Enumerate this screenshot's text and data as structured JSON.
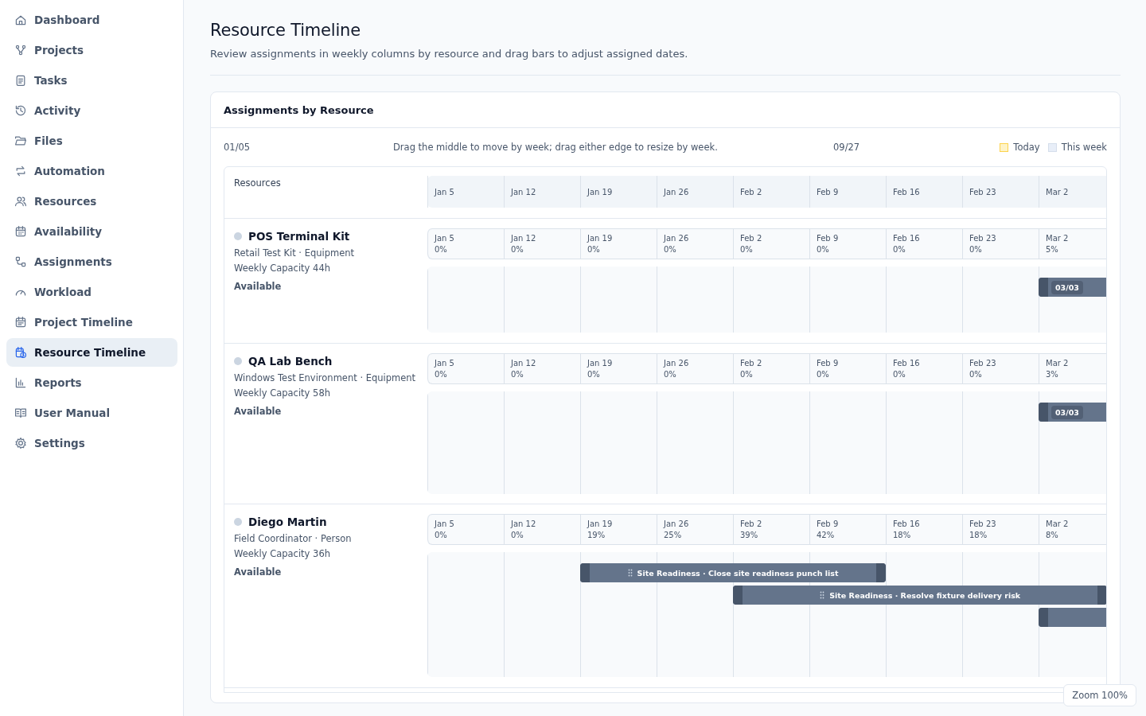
{
  "sidebar": {
    "items": [
      {
        "label": "Dashboard",
        "selected": false
      },
      {
        "label": "Projects",
        "selected": false
      },
      {
        "label": "Tasks",
        "selected": false
      },
      {
        "label": "Activity",
        "selected": false
      },
      {
        "label": "Files",
        "selected": false
      },
      {
        "label": "Automation",
        "selected": false
      },
      {
        "label": "Resources",
        "selected": false
      },
      {
        "label": "Availability",
        "selected": false
      },
      {
        "label": "Assignments",
        "selected": false
      },
      {
        "label": "Workload",
        "selected": false
      },
      {
        "label": "Project Timeline",
        "selected": false
      },
      {
        "label": "Resource Timeline",
        "selected": true
      },
      {
        "label": "Reports",
        "selected": false
      },
      {
        "label": "User Manual",
        "selected": false
      },
      {
        "label": "Settings",
        "selected": false
      }
    ]
  },
  "page": {
    "title": "Resource Timeline",
    "subtitle": "Review assignments in weekly columns by resource and drag bars to adjust assigned dates."
  },
  "card": {
    "title": "Assignments by Resource",
    "range_start": "01/05",
    "hint": "Drag the middle to move by week; drag either edge to resize by week.",
    "range_end": "09/27",
    "legend": [
      {
        "label": "Today",
        "color": "#fef3c7"
      },
      {
        "label": "This week",
        "color": "#e8eef8"
      }
    ],
    "resources_heading": "Resources",
    "weeks": [
      "Jan 5",
      "Jan 12",
      "Jan 19",
      "Jan 26",
      "Feb 2",
      "Feb 9",
      "Feb 16",
      "Feb 23",
      "Mar 2"
    ],
    "resources": [
      {
        "name": "POS Terminal Kit",
        "color": "#cbd5e1",
        "detail": "Retail Test Kit · Equipment",
        "capacity": "Weekly Capacity 44h",
        "status": "Available",
        "load": [
          {
            "week": "Jan 5",
            "value": "0%"
          },
          {
            "week": "Jan 12",
            "value": "0%"
          },
          {
            "week": "Jan 19",
            "value": "0%"
          },
          {
            "week": "Jan 26",
            "value": "0%"
          },
          {
            "week": "Feb 2",
            "value": "0%"
          },
          {
            "week": "Feb 9",
            "value": "0%"
          },
          {
            "week": "Feb 16",
            "value": "0%"
          },
          {
            "week": "Feb 23",
            "value": "0%"
          },
          {
            "week": "Mar 2",
            "value": "5%"
          }
        ],
        "bars": [
          {
            "kind": "chip",
            "label": "03/03"
          }
        ]
      },
      {
        "name": "QA Lab Bench",
        "color": "#cbd5e1",
        "detail": "Windows Test Environment · Equipment",
        "capacity": "Weekly Capacity 58h",
        "status": "Available",
        "load": [
          {
            "week": "Jan 5",
            "value": "0%"
          },
          {
            "week": "Jan 12",
            "value": "0%"
          },
          {
            "week": "Jan 19",
            "value": "0%"
          },
          {
            "week": "Jan 26",
            "value": "0%"
          },
          {
            "week": "Feb 2",
            "value": "0%"
          },
          {
            "week": "Feb 9",
            "value": "0%"
          },
          {
            "week": "Feb 16",
            "value": "0%"
          },
          {
            "week": "Feb 23",
            "value": "0%"
          },
          {
            "week": "Mar 2",
            "value": "3%"
          }
        ],
        "bars": [
          {
            "kind": "chip",
            "label": "03/03"
          }
        ]
      },
      {
        "name": "Diego Martin",
        "color": "#cbd5e1",
        "detail": "Field Coordinator · Person",
        "capacity": "Weekly Capacity 36h",
        "status": "Available",
        "load": [
          {
            "week": "Jan 5",
            "value": "0%"
          },
          {
            "week": "Jan 12",
            "value": "0%"
          },
          {
            "week": "Jan 19",
            "value": "19%"
          },
          {
            "week": "Jan 26",
            "value": "25%"
          },
          {
            "week": "Feb 2",
            "value": "39%"
          },
          {
            "week": "Feb 9",
            "value": "42%"
          },
          {
            "week": "Feb 16",
            "value": "18%"
          },
          {
            "week": "Feb 23",
            "value": "18%"
          },
          {
            "week": "Mar 2",
            "value": "8%"
          }
        ],
        "bars": [
          {
            "kind": "titled",
            "label": "Site Readiness · Close site readiness punch list"
          },
          {
            "kind": "titled",
            "label": "Site Readiness · Resolve fixture delivery risk"
          },
          {
            "kind": "plain"
          }
        ]
      }
    ]
  },
  "zoom": "Zoom 100%"
}
